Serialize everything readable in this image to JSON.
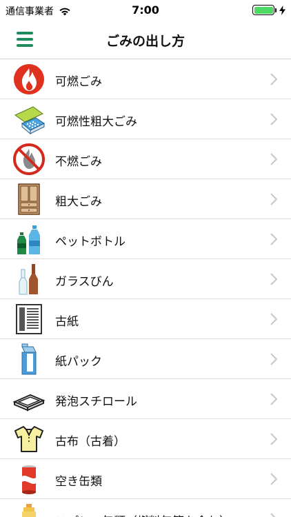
{
  "status_bar": {
    "carrier": "通信事業者",
    "time": "7:00",
    "battery_level": 1.0,
    "battery_color": "#4cd964"
  },
  "nav": {
    "title": "ごみの出し方",
    "accent_color": "#1f8a5b",
    "menu_icon": "hamburger-menu-icon"
  },
  "items": [
    {
      "label": "可燃ごみ",
      "icon": "flame-icon"
    },
    {
      "label": "可燃性粗大ごみ",
      "icon": "mattress-icon"
    },
    {
      "label": "不燃ごみ",
      "icon": "no-burn-icon"
    },
    {
      "label": "粗大ごみ",
      "icon": "cabinet-icon"
    },
    {
      "label": "ペットボトル",
      "icon": "pet-bottle-icon"
    },
    {
      "label": "ガラスびん",
      "icon": "glass-bottle-icon"
    },
    {
      "label": "古紙",
      "icon": "newspaper-icon"
    },
    {
      "label": "紙パック",
      "icon": "milk-carton-icon"
    },
    {
      "label": "発泡スチロール",
      "icon": "styrofoam-tray-icon"
    },
    {
      "label": "古布（古着）",
      "icon": "shirt-icon"
    },
    {
      "label": "空き缶類",
      "icon": "soda-can-icon"
    },
    {
      "label": "スプレー缶類（燃料缶等を含む）",
      "icon": "spray-can-icon"
    }
  ]
}
